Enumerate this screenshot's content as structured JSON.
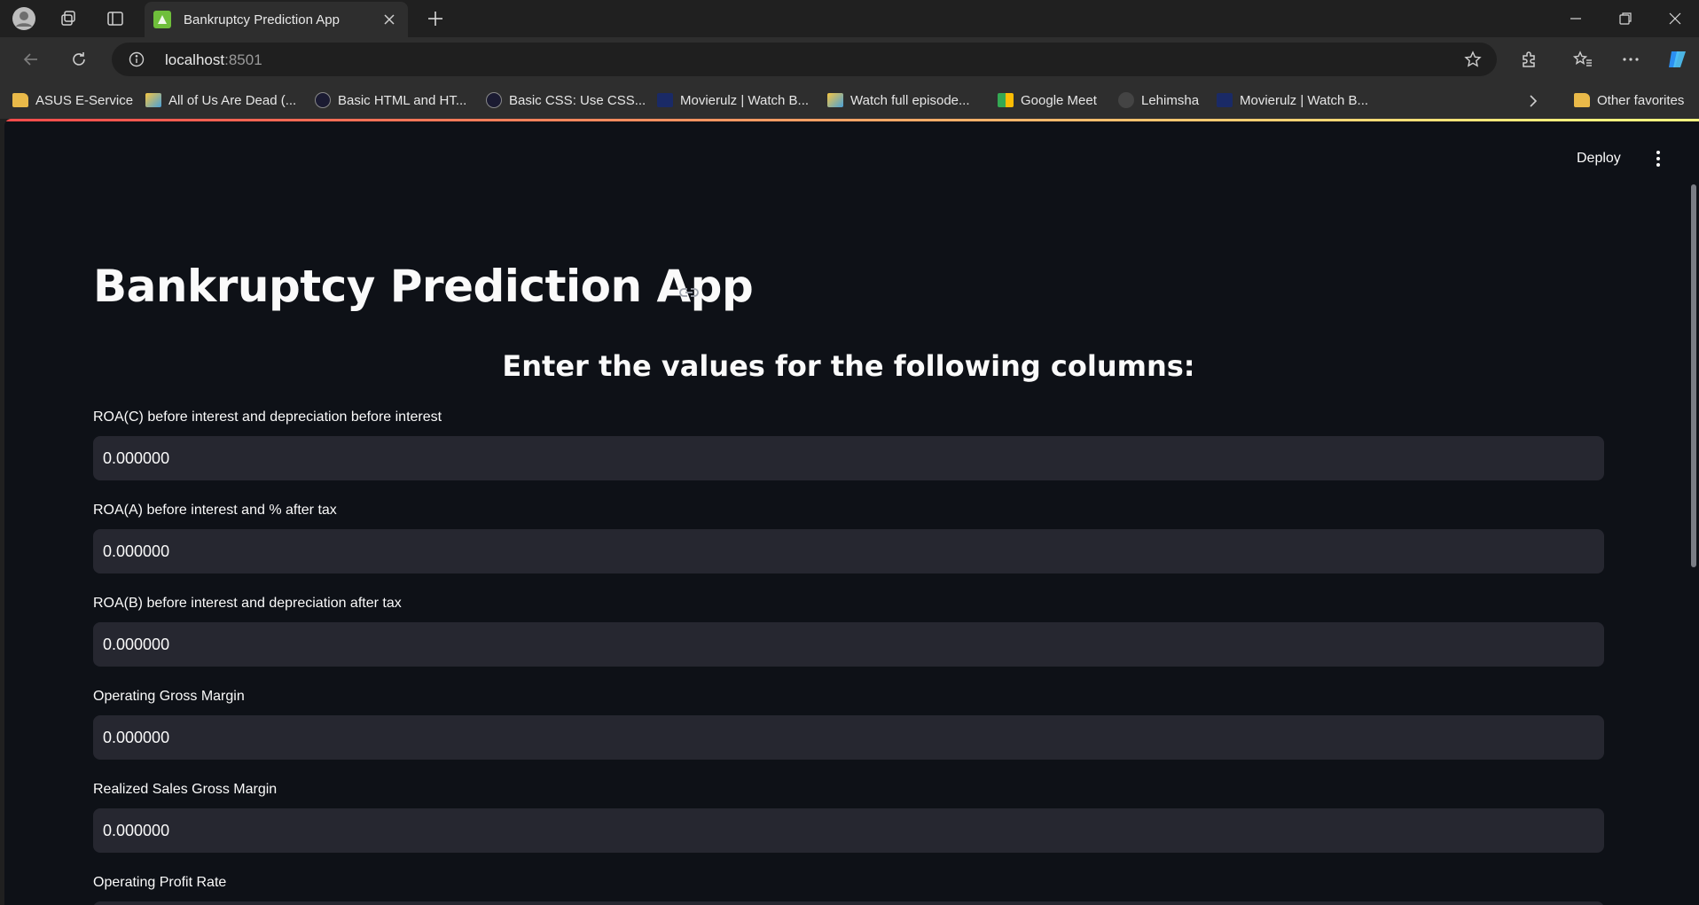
{
  "browser": {
    "tab_title": "Bankruptcy Prediction App",
    "address_host": "localhost",
    "address_port": ":8501",
    "bookmarks": [
      {
        "label": "ASUS E-Service",
        "icon": "folder-icon"
      },
      {
        "label": "All of Us Are Dead (...",
        "icon": "site-icon"
      },
      {
        "label": "Basic HTML and HT...",
        "icon": "freecodecamp-icon"
      },
      {
        "label": "Basic CSS: Use CSS...",
        "icon": "freecodecamp-icon"
      },
      {
        "label": "Movierulz | Watch B...",
        "icon": "movierulz-icon"
      },
      {
        "label": "Watch full episode...",
        "icon": "site-icon"
      },
      {
        "label": "Google Meet",
        "icon": "google-meet-icon"
      },
      {
        "label": "Lehimsha",
        "icon": "github-icon"
      },
      {
        "label": "Movierulz | Watch B...",
        "icon": "movierulz-icon"
      }
    ],
    "other_favorites": "Other favorites"
  },
  "app": {
    "deploy_label": "Deploy",
    "title": "Bankruptcy Prediction App",
    "subheader": "Enter the values for the following columns:",
    "fields": [
      {
        "label": "ROA(C) before interest and depreciation before interest",
        "value": "0.000000"
      },
      {
        "label": "ROA(A) before interest and % after tax",
        "value": "0.000000"
      },
      {
        "label": "ROA(B) before interest and depreciation after tax",
        "value": "0.000000"
      },
      {
        "label": "Operating Gross Margin",
        "value": "0.000000"
      },
      {
        "label": "Realized Sales Gross Margin",
        "value": "0.000000"
      },
      {
        "label": "Operating Profit Rate",
        "value": ""
      }
    ]
  },
  "colors": {
    "app_background": "#0e1117",
    "input_background": "#262730",
    "browser_chrome": "#202020",
    "toolbar": "#2e2e2e"
  }
}
